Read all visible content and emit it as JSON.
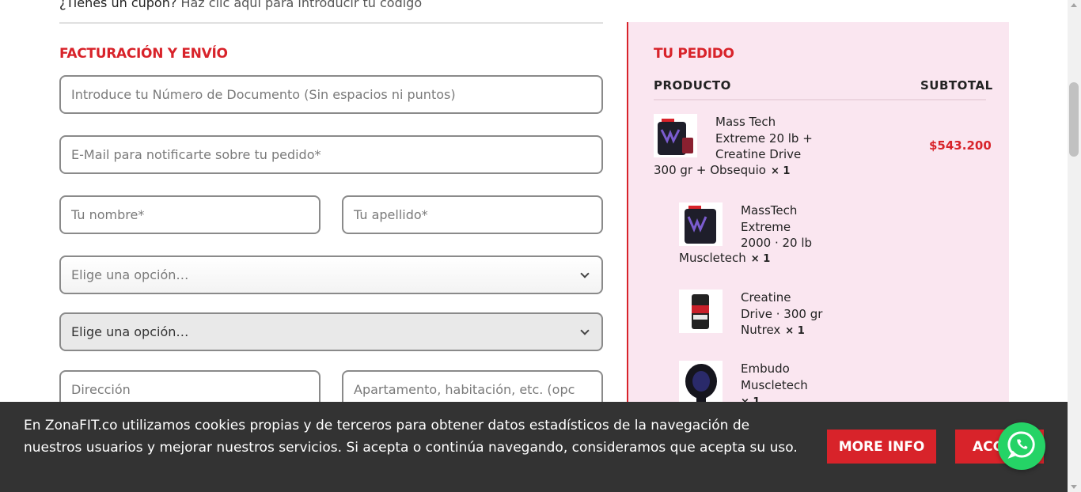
{
  "coupon": {
    "question": "¿Tienes un cupón?",
    "link": "Haz clic aquí para introducir tu código"
  },
  "billing": {
    "title": "FACTURACIÓN Y ENVÍO",
    "document_placeholder": "Introduce tu Número de Documento (Sin espacios ni puntos)",
    "email_placeholder": "E-Mail para notificarte sobre tu pedido*",
    "first_name_placeholder": "Tu nombre*",
    "last_name_placeholder": "Tu apellido*",
    "select1_value": "Elige una opción…",
    "select2_value": "Elige una opción…",
    "address_placeholder": "Dirección",
    "apartment_placeholder": "Apartamento, habitación, etc. (opc"
  },
  "order": {
    "title": "TU PEDIDO",
    "col_product": "PRODUCTO",
    "col_subtotal": "SUBTOTAL",
    "items": [
      {
        "lines": [
          "Mass Tech",
          "Extreme 20 lb +",
          "Creatine Drive"
        ],
        "last": "300 gr + Obsequio",
        "qty": "× 1",
        "price": "$543.200"
      },
      {
        "lines": [
          "MassTech",
          "Extreme",
          "2000 · 20 lb"
        ],
        "last": "Muscletech",
        "qty": "× 1"
      },
      {
        "lines": [
          "Creatine",
          "Drive · 300 gr"
        ],
        "last": "Nutrex",
        "qty": "× 1"
      },
      {
        "lines": [
          "Embudo",
          "Muscletech"
        ],
        "last": "",
        "qty": "× 1"
      }
    ]
  },
  "cookie": {
    "text": "En ZonaFIT.co utilizamos cookies propias y de terceros para obtener datos estadísticos de la navegación de nuestros usuarios y mejorar nuestros servicios. Si acepta o continúa navegando, consideramos que acepta su uso.",
    "more_info": "MORE INFO",
    "accept": "ACCEPT"
  },
  "icons": {
    "whatsapp": "whatsapp-icon",
    "chevron": "chevron-down-icon"
  },
  "colors": {
    "brand_red": "#d8232a",
    "order_bg": "#fae6f0",
    "cookie_bg": "#333333",
    "whatsapp_green": "#25d366"
  }
}
